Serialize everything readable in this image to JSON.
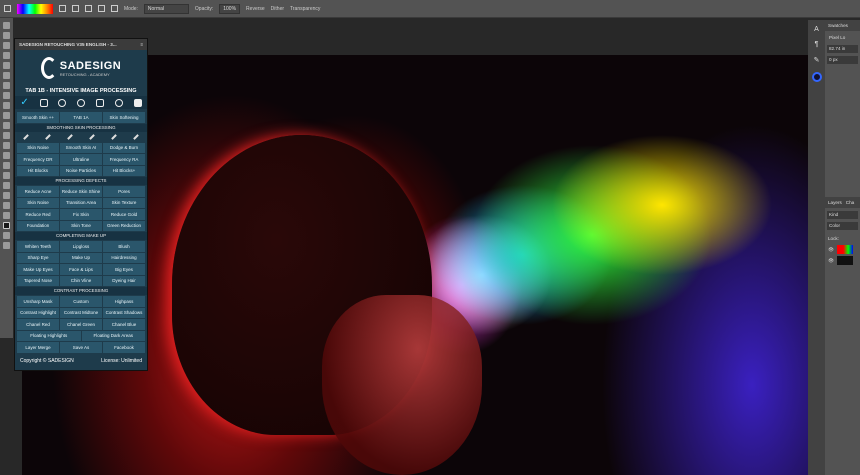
{
  "options_bar": {
    "mode_label": "Mode:",
    "mode_value": "Normal",
    "opacity_label": "Opacity:",
    "opacity_value": "100%",
    "reverse": "Reverse",
    "dither": "Dither",
    "transparency": "Transparency"
  },
  "panel": {
    "title": "SADESIGN RETOUCHING V35 ENGLISH - 3...",
    "logo_name": "SADESIGN",
    "logo_sub": "RETOUCHING - ACADEMY",
    "tab_title": "TAB 1B - INTENSIVE IMAGE PROCESSING",
    "top_row": [
      "Smooth Skin ++",
      "TAB 1A",
      "Skin Softening"
    ],
    "sections": [
      {
        "heading": "SMOOTHING SKIN PROCESSING",
        "rows": [
          [
            "Skin Noise",
            "Smooth Skin AI",
            "Dodge & Burn"
          ],
          [
            "Frequency DR",
            "Ultraline",
            "Frequency RA"
          ],
          [
            "Hit Blocks",
            "Noise Particles",
            "Hit Blocks+"
          ]
        ]
      },
      {
        "heading": "PROCESSING DEFECTS",
        "rows": [
          [
            "Reduce Acne",
            "Reduce Skin Shine",
            "Pores"
          ],
          [
            "Skin Noise",
            "Transition Area",
            "Skin Texture"
          ],
          [
            "Reduce Red",
            "Fix Skin",
            "Reduce Gold"
          ],
          [
            "Foundation",
            "Skin Tone",
            "Green Reduction"
          ]
        ]
      },
      {
        "heading": "COMPLETING MAKE UP",
        "rows": [
          [
            "Whiten Teeth",
            "Lipgloss",
            "Blush"
          ],
          [
            "Sharp Eye",
            "Make Up",
            "Hairdressing"
          ],
          [
            "Make Up Eyes",
            "Face & Lips",
            "Big Eyes"
          ],
          [
            "Tapered Nose",
            "Chin Vline",
            "Dyeing Hair"
          ]
        ]
      },
      {
        "heading": "CONTRAST PROCESSING",
        "rows": [
          [
            "Unsharp Mask",
            "Custom",
            "Highpass"
          ],
          [
            "Contrast Highlight",
            "Contrast Midtone",
            "Contrast Shadows"
          ],
          [
            "Chanel Red",
            "Chanel Green",
            "Chanel Blue"
          ],
          [
            "Floating Highlights",
            "Floating Dark Areas"
          ],
          [
            "Layer Merge",
            "Save As",
            "Facebook"
          ]
        ]
      }
    ],
    "copyright": "Copyright © SADESIGN",
    "license": "License: Unlimited"
  },
  "right": {
    "tab_swatches": "Swatches",
    "pixel_label": "Pixel Lo",
    "w_value": "82.74 in",
    "x_value": "0 px",
    "tab_layers": "Layers",
    "tab_channels": "Cha",
    "kind": "Kind",
    "color": "Color",
    "lock": "Lock:"
  }
}
